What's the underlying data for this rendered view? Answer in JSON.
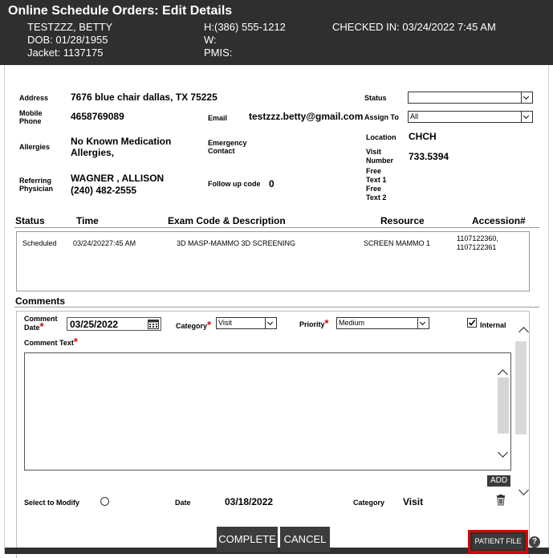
{
  "header": {
    "title": "Online Schedule Orders: Edit Details",
    "patient_name": "TESTZZZ, BETTY",
    "dob": "DOB: 01/28/1955",
    "jacket": "Jacket: 1137175",
    "phone_h": "H:(386) 555-1212",
    "phone_w": "W:",
    "pmis": "PMIS:",
    "checked_in": "CHECKED IN: 03/24/2022 7:45 AM"
  },
  "details": {
    "address_label": "Address",
    "address_value": "7676 blue chair dallas, TX 75225",
    "mobile_label_1": "Mobile",
    "mobile_label_2": "Phone",
    "mobile_value": "4658769089",
    "email_label": "Email",
    "email_value": "testzzz.betty@gmail.com",
    "allergies_label": "Allergies",
    "allergies_value_1": "No Known Medication",
    "allergies_value_2": "Allergies,",
    "emergency_label_1": "Emergency",
    "emergency_label_2": "Contact",
    "referring_label_1": "Referring",
    "referring_label_2": "Physician",
    "referring_value_1": "WAGNER , ALLISON",
    "referring_value_2": "(240) 482-2555",
    "followup_label": "Follow up code",
    "followup_value": "0",
    "status_label": "Status",
    "status_value": "",
    "assign_label": "Assign To",
    "assign_value": "All",
    "location_label": "Location",
    "location_value": "CHCH",
    "visit_label_1": "Visit",
    "visit_label_2": "Number",
    "visit_value": "733.5394",
    "free1_label_1": "Free",
    "free1_label_2": "Text 1",
    "free2_label_1": "Free",
    "free2_label_2": "Text 2"
  },
  "orders": {
    "columns": [
      "Status",
      "Time",
      "Exam Code & Description",
      "Resource",
      "Accession#"
    ],
    "rows": [
      {
        "status": "Scheduled",
        "time": "03/24/20227:45 AM",
        "exam": "3D MASP-MAMMO 3D SCREENING",
        "resource": "SCREEN MAMMO 1",
        "accession_1": "1107122360,",
        "accession_2": "1107122361"
      }
    ]
  },
  "comments": {
    "section_title": "Comments",
    "date_label_1": "Comment",
    "date_label_2": "Date",
    "date_value": "03/25/2022",
    "category_label": "Category",
    "category_value": "Visit",
    "priority_label": "Priority",
    "priority_value": "Medium",
    "internal_label": "Internal",
    "text_label": "Comment Text",
    "text_value": "",
    "add_label": "ADD",
    "list_select_label": "Select to Modify",
    "list_date_label": "Date",
    "list_date_value": "03/18/2022",
    "list_category_label": "Category",
    "list_category_value": "Visit"
  },
  "footer": {
    "complete_label": "COMPLETE",
    "cancel_label": "CANCEL",
    "patient_file_label": "PATIENT FILE",
    "help_glyph": "?"
  },
  "colors": {
    "header_bg": "#2f2f2f",
    "highlight": "#e00000",
    "required": "#d40000"
  }
}
